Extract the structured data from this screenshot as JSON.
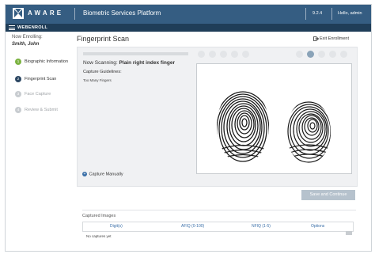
{
  "header": {
    "logo_text": "AWARE",
    "platform": "Biometric Services Platform",
    "version": "9.2.4",
    "user_greeting": "Hello, admin"
  },
  "subheader": {
    "title": "WEBENROLL"
  },
  "sidebar": {
    "enrolling_label": "Now Enrolling:",
    "enrollee_name": "Smith, John",
    "steps": [
      {
        "number": "1",
        "label": "Biographic Information",
        "state": "done"
      },
      {
        "number": "2",
        "label": "Fingerprint Scan",
        "state": "active"
      },
      {
        "number": "3",
        "label": "Face Capture",
        "state": "pending"
      },
      {
        "number": "4",
        "label": "Review & Submit",
        "state": "pending"
      }
    ]
  },
  "main": {
    "title": "Fingerprint Scan",
    "exit_label": "Exit Enrollment",
    "scan": {
      "now_scanning_label": "Now Scanning:",
      "finger": "Plain right index finger",
      "guidelines_label": "Capture Guidelines:",
      "guideline": "Too Many Fingers",
      "capture_manually": "Capture Manually",
      "finger_progress": {
        "total": 10,
        "current": 6
      }
    },
    "save_button": "Save and Continue",
    "captured": {
      "title": "Captured Images",
      "columns": [
        "Digit(s)",
        "AFIQ (0-100)",
        "NFIQ (1-5)",
        "Options"
      ],
      "empty_text": "No captures yet"
    }
  },
  "colors": {
    "header": "#355d82",
    "subheader": "#1f3d58",
    "done": "#7cb342",
    "active": "#2c4763",
    "pending": "#c8ccd0",
    "button_disabled": "#b6c2cd"
  }
}
